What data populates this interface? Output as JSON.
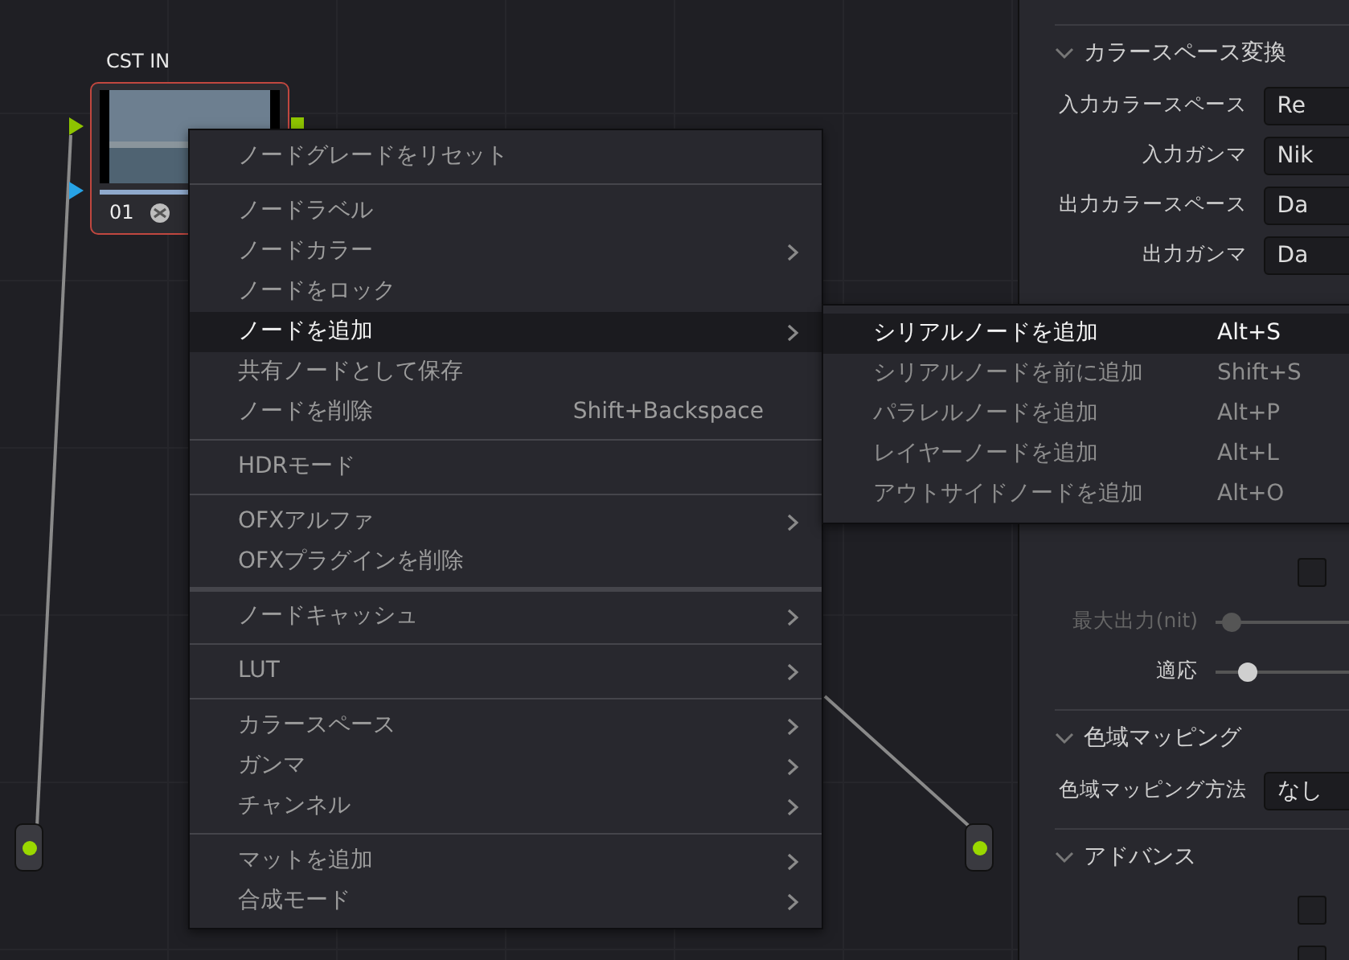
{
  "node_editor": {
    "node": {
      "label": "CST IN",
      "number": "01",
      "selected": true
    }
  },
  "context_menu": {
    "groups": [
      {
        "items": [
          {
            "label": "ノードグレードをリセット",
            "submenu": false,
            "selected": false
          }
        ]
      },
      {
        "items": [
          {
            "label": "ノードラベル",
            "submenu": false,
            "selected": false
          },
          {
            "label": "ノードカラー",
            "submenu": true,
            "selected": false
          },
          {
            "label": "ノードをロック",
            "submenu": false,
            "selected": false
          },
          {
            "label": "ノードを追加",
            "submenu": true,
            "selected": true
          },
          {
            "label": "共有ノードとして保存",
            "submenu": false,
            "selected": false
          },
          {
            "label": "ノードを削除",
            "shortcut": "Shift+Backspace",
            "submenu": false,
            "selected": false
          }
        ]
      },
      {
        "items": [
          {
            "label": "HDRモード",
            "submenu": false,
            "selected": false
          }
        ]
      },
      {
        "items": [
          {
            "label": "OFXアルファ",
            "submenu": true,
            "selected": false
          },
          {
            "label": "OFXプラグインを削除",
            "submenu": false,
            "selected": false
          }
        ]
      },
      {
        "items": [
          {
            "label": "ノードキャッシュ",
            "submenu": true,
            "selected": false
          }
        ]
      },
      {
        "items": [
          {
            "label": "LUT",
            "submenu": true,
            "selected": false
          }
        ]
      },
      {
        "items": [
          {
            "label": "カラースペース",
            "submenu": true,
            "selected": false
          },
          {
            "label": "ガンマ",
            "submenu": true,
            "selected": false
          },
          {
            "label": "チャンネル",
            "submenu": true,
            "selected": false
          }
        ]
      },
      {
        "items": [
          {
            "label": "マットを追加",
            "submenu": true,
            "selected": false
          },
          {
            "label": "合成モード",
            "submenu": true,
            "selected": false
          }
        ]
      }
    ]
  },
  "submenu": {
    "items": [
      {
        "label": "シリアルノードを追加",
        "shortcut": "Alt+S",
        "selected": true
      },
      {
        "label": "シリアルノードを前に追加",
        "shortcut": "Shift+S",
        "selected": false
      },
      {
        "label": "パラレルノードを追加",
        "shortcut": "Alt+P",
        "selected": false
      },
      {
        "label": "レイヤーノードを追加",
        "shortcut": "Alt+L",
        "selected": false
      },
      {
        "label": "アウトサイドノードを追加",
        "shortcut": "Alt+O",
        "selected": false
      }
    ]
  },
  "inspector": {
    "sections": [
      {
        "title": "カラースペース変換",
        "expanded": true,
        "groups": [
          [
            {
              "kind": "dropdown",
              "label": "入力カラースペース",
              "value": "Re"
            },
            {
              "kind": "dropdown",
              "label": "入力ガンマ",
              "value": "Nik"
            },
            {
              "kind": "dropdown",
              "label": "出力カラースペース",
              "value": "Da"
            },
            {
              "kind": "dropdown",
              "label": "出力ガンマ",
              "value": "Da"
            }
          ],
          [
            {
              "kind": "checkbox",
              "checked": false
            },
            {
              "kind": "slider",
              "label": "最大出力(nit)",
              "disabled": true,
              "level": 0.05
            },
            {
              "kind": "slider",
              "label": "適応",
              "disabled": false,
              "level": 0.1
            }
          ]
        ]
      },
      {
        "title": "色域マッピング",
        "expanded": true,
        "groups": [
          [
            {
              "kind": "dropdown",
              "label": "色域マッピング方法",
              "value": "なし"
            }
          ]
        ]
      },
      {
        "title": "アドバンス",
        "expanded": true,
        "groups": [
          [
            {
              "kind": "checkbox",
              "checked": false
            },
            {
              "kind": "checkbox",
              "checked": false
            }
          ]
        ]
      }
    ]
  }
}
